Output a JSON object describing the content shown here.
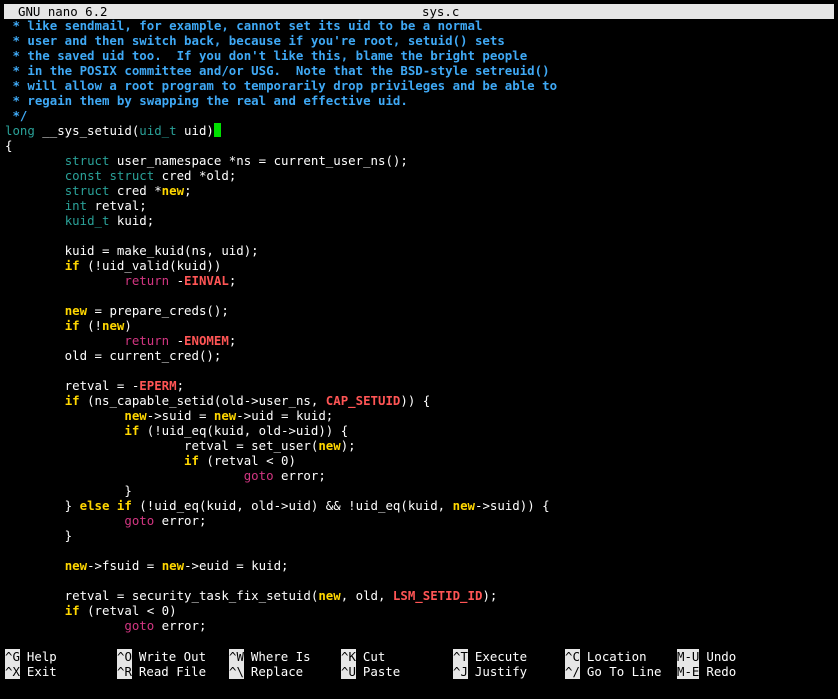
{
  "app_title": "GNU nano 6.2",
  "file_name": "sys.c",
  "colors": {
    "comment": "#3fa9f5",
    "type": "#2aa198",
    "keyword": "#ffd700",
    "control": "#d33682",
    "constant": "#ff5555",
    "cursor": "#00e000",
    "titlebar": "#e6e6e6"
  },
  "code_lines": [
    [
      [
        "c",
        " * like sendmail, for example, cannot set its uid to be a normal"
      ]
    ],
    [
      [
        "c",
        " * user and then switch back, because if you're root, setuid() sets"
      ]
    ],
    [
      [
        "c",
        " * the saved uid too.  If you don't like this, blame the bright people"
      ]
    ],
    [
      [
        "c",
        " * in the POSIX committee and/or USG.  Note that the BSD-style setreuid()"
      ]
    ],
    [
      [
        "c",
        " * will allow a root program to temporarily drop privileges and be able to"
      ]
    ],
    [
      [
        "c",
        " * regain them by swapping the real and effective uid."
      ]
    ],
    [
      [
        "c",
        " */"
      ]
    ],
    [
      [
        "t",
        "long"
      ],
      [
        "p",
        " __sys_setuid("
      ],
      [
        "t",
        "uid_t"
      ],
      [
        "p",
        " uid)"
      ],
      [
        "cursor",
        ""
      ]
    ],
    [
      [
        "p",
        "{"
      ]
    ],
    [
      [
        "p",
        "        "
      ],
      [
        "t",
        "struct"
      ],
      [
        "p",
        " user_namespace *ns = current_user_ns();"
      ]
    ],
    [
      [
        "p",
        "        "
      ],
      [
        "t",
        "const struct"
      ],
      [
        "p",
        " cred *old;"
      ]
    ],
    [
      [
        "p",
        "        "
      ],
      [
        "t",
        "struct"
      ],
      [
        "p",
        " cred *"
      ],
      [
        "k",
        "new"
      ],
      [
        "p",
        ";"
      ]
    ],
    [
      [
        "p",
        "        "
      ],
      [
        "t",
        "int"
      ],
      [
        "p",
        " retval;"
      ]
    ],
    [
      [
        "p",
        "        "
      ],
      [
        "t",
        "kuid_t"
      ],
      [
        "p",
        " kuid;"
      ]
    ],
    [
      [
        "p",
        ""
      ]
    ],
    [
      [
        "p",
        "        kuid = make_kuid(ns, uid);"
      ]
    ],
    [
      [
        "p",
        "        "
      ],
      [
        "k",
        "if"
      ],
      [
        "p",
        " (!uid_valid(kuid))"
      ]
    ],
    [
      [
        "p",
        "                "
      ],
      [
        "r",
        "return"
      ],
      [
        "p",
        " -"
      ],
      [
        "e",
        "EINVAL"
      ],
      [
        "p",
        ";"
      ]
    ],
    [
      [
        "p",
        ""
      ]
    ],
    [
      [
        "p",
        "        "
      ],
      [
        "k",
        "new"
      ],
      [
        "p",
        " = prepare_creds();"
      ]
    ],
    [
      [
        "p",
        "        "
      ],
      [
        "k",
        "if"
      ],
      [
        "p",
        " (!"
      ],
      [
        "k",
        "new"
      ],
      [
        "p",
        ")"
      ]
    ],
    [
      [
        "p",
        "                "
      ],
      [
        "r",
        "return"
      ],
      [
        "p",
        " -"
      ],
      [
        "e",
        "ENOMEM"
      ],
      [
        "p",
        ";"
      ]
    ],
    [
      [
        "p",
        "        old = current_cred();"
      ]
    ],
    [
      [
        "p",
        ""
      ]
    ],
    [
      [
        "p",
        "        retval = -"
      ],
      [
        "e",
        "EPERM"
      ],
      [
        "p",
        ";"
      ]
    ],
    [
      [
        "p",
        "        "
      ],
      [
        "k",
        "if"
      ],
      [
        "p",
        " (ns_capable_setid(old->user_ns, "
      ],
      [
        "e",
        "CAP_SETUID"
      ],
      [
        "p",
        ")) {"
      ]
    ],
    [
      [
        "p",
        "                "
      ],
      [
        "k",
        "new"
      ],
      [
        "p",
        "->suid = "
      ],
      [
        "k",
        "new"
      ],
      [
        "p",
        "->uid = kuid;"
      ]
    ],
    [
      [
        "p",
        "                "
      ],
      [
        "k",
        "if"
      ],
      [
        "p",
        " (!uid_eq(kuid, old->uid)) {"
      ]
    ],
    [
      [
        "p",
        "                        retval = set_user("
      ],
      [
        "k",
        "new"
      ],
      [
        "p",
        ");"
      ]
    ],
    [
      [
        "p",
        "                        "
      ],
      [
        "k",
        "if"
      ],
      [
        "p",
        " (retval < 0)"
      ]
    ],
    [
      [
        "p",
        "                                "
      ],
      [
        "r",
        "goto"
      ],
      [
        "p",
        " error;"
      ]
    ],
    [
      [
        "p",
        "                }"
      ]
    ],
    [
      [
        "p",
        "        } "
      ],
      [
        "k",
        "else if"
      ],
      [
        "p",
        " (!uid_eq(kuid, old->uid) && !uid_eq(kuid, "
      ],
      [
        "k",
        "new"
      ],
      [
        "p",
        "->suid)) {"
      ]
    ],
    [
      [
        "p",
        "                "
      ],
      [
        "r",
        "goto"
      ],
      [
        "p",
        " error;"
      ]
    ],
    [
      [
        "p",
        "        }"
      ]
    ],
    [
      [
        "p",
        ""
      ]
    ],
    [
      [
        "p",
        "        "
      ],
      [
        "k",
        "new"
      ],
      [
        "p",
        "->fsuid = "
      ],
      [
        "k",
        "new"
      ],
      [
        "p",
        "->euid = kuid;"
      ]
    ],
    [
      [
        "p",
        ""
      ]
    ],
    [
      [
        "p",
        "        retval = security_task_fix_setuid("
      ],
      [
        "k",
        "new"
      ],
      [
        "p",
        ", old, "
      ],
      [
        "e",
        "LSM_SETID_ID"
      ],
      [
        "p",
        ");"
      ]
    ],
    [
      [
        "p",
        "        "
      ],
      [
        "k",
        "if"
      ],
      [
        "p",
        " (retval < 0)"
      ]
    ],
    [
      [
        "p",
        "                "
      ],
      [
        "r",
        "goto"
      ],
      [
        "p",
        " error;"
      ]
    ]
  ],
  "shortcuts": [
    {
      "key": "^G",
      "label": "Help"
    },
    {
      "key": "^X",
      "label": "Exit"
    },
    {
      "key": "^O",
      "label": "Write Out"
    },
    {
      "key": "^R",
      "label": "Read File"
    },
    {
      "key": "^W",
      "label": "Where Is"
    },
    {
      "key": "^\\",
      "label": "Replace"
    },
    {
      "key": "^K",
      "label": "Cut"
    },
    {
      "key": "^U",
      "label": "Paste"
    },
    {
      "key": "^T",
      "label": "Execute"
    },
    {
      "key": "^J",
      "label": "Justify"
    },
    {
      "key": "^C",
      "label": "Location"
    },
    {
      "key": "^/",
      "label": "Go To Line"
    },
    {
      "key": "M-U",
      "label": "Undo"
    },
    {
      "key": "M-E",
      "label": "Redo"
    }
  ]
}
